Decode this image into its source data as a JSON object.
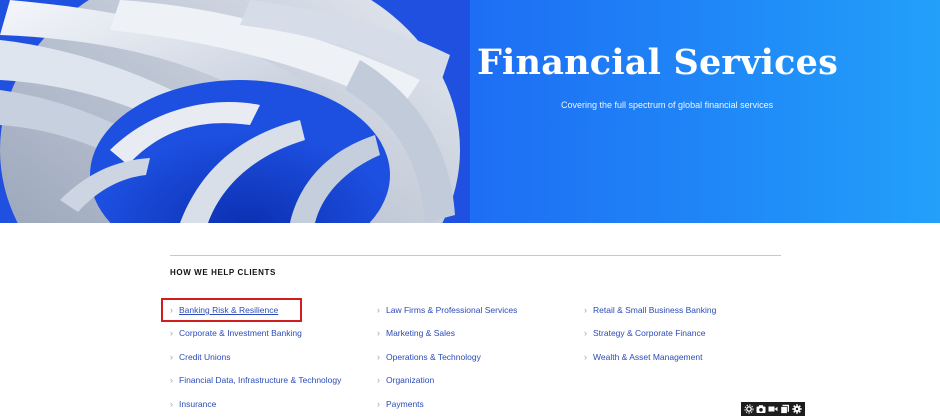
{
  "hero": {
    "title": "Financial Services",
    "subtitle": "Covering the full spectrum of global financial services",
    "gradient_colors": [
      "#1f4fe6",
      "#23a0fa"
    ]
  },
  "section": {
    "heading": "HOW WE HELP CLIENTS"
  },
  "services": {
    "columns": [
      [
        "Banking Risk & Resilience",
        "Corporate & Investment Banking",
        "Credit Unions",
        "Financial Data, Infrastructure & Technology",
        "Insurance"
      ],
      [
        "Law Firms & Professional Services",
        "Marketing & Sales",
        "Operations & Technology",
        "Organization",
        "Payments"
      ],
      [
        "Retail & Small Business Banking",
        "Strategy & Corporate Finance",
        "Wealth & Asset Management"
      ]
    ],
    "highlighted": "Banking Risk & Resilience",
    "link_color": "#2b4bb8",
    "highlight_color": "#d11d1d"
  },
  "toolbar": {
    "icons": [
      "settings-gear-icon",
      "camera-icon",
      "video-icon",
      "copy-icon",
      "gear-icon"
    ]
  }
}
